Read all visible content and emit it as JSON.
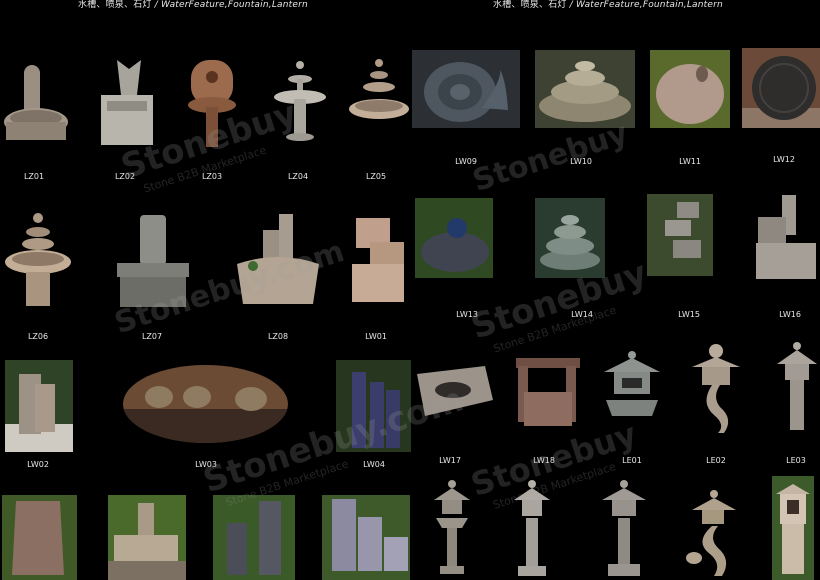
{
  "headers": [
    {
      "cn": "水槽、喷泉、石灯",
      "en": "/ WaterFeature,Fountain,Lantern"
    },
    {
      "cn": "水槽、喷泉、石灯",
      "en": "/ WaterFeature,Fountain,Lantern"
    }
  ],
  "watermark": {
    "brand": "Stonebuy",
    "tagline": "Stone B2B Marketplace",
    "domain": ".com"
  },
  "items": [
    {
      "code": "LZ01"
    },
    {
      "code": "LZ02"
    },
    {
      "code": "LZ03"
    },
    {
      "code": "LZ04"
    },
    {
      "code": "LZ05"
    },
    {
      "code": "LW09"
    },
    {
      "code": "LW10"
    },
    {
      "code": "LW11"
    },
    {
      "code": "LW12"
    },
    {
      "code": "LZ06"
    },
    {
      "code": "LZ07"
    },
    {
      "code": "LZ08"
    },
    {
      "code": "LW01"
    },
    {
      "code": "LW13"
    },
    {
      "code": "LW14"
    },
    {
      "code": "LW15"
    },
    {
      "code": "LW16"
    },
    {
      "code": "LW02"
    },
    {
      "code": "LW03"
    },
    {
      "code": "LW04"
    },
    {
      "code": "LW17"
    },
    {
      "code": "LW18"
    },
    {
      "code": "LE01"
    },
    {
      "code": "LE02"
    },
    {
      "code": "LE03"
    },
    {
      "code": ""
    },
    {
      "code": ""
    },
    {
      "code": ""
    },
    {
      "code": ""
    },
    {
      "code": ""
    },
    {
      "code": ""
    },
    {
      "code": ""
    },
    {
      "code": ""
    },
    {
      "code": ""
    }
  ]
}
